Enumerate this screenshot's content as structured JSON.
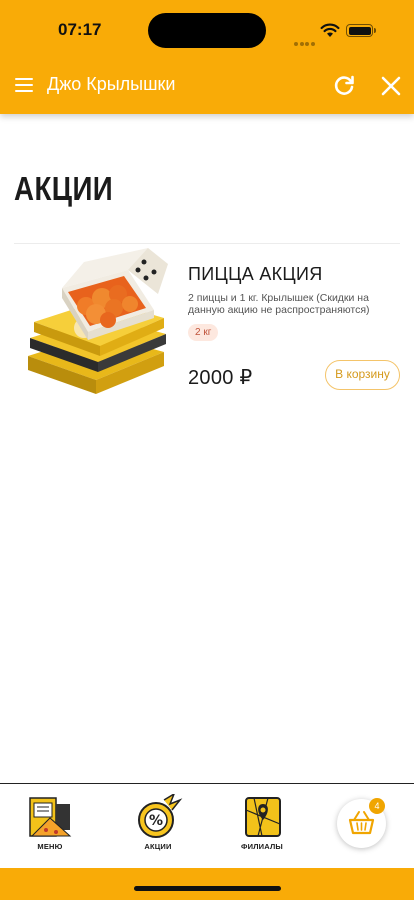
{
  "status_bar": {
    "time": "07:17"
  },
  "header": {
    "title": "Джо Крылышки"
  },
  "page": {
    "title": "АКЦИИ"
  },
  "products": [
    {
      "name": "ПИЦЦА АКЦИЯ",
      "description": "2 пиццы и 1 кг. Крылышек (Скидки на данную акцию не распространяются)",
      "weight": "2 кг",
      "price": "2000 ₽",
      "cart_label": "В корзину"
    }
  ],
  "tabbar": {
    "tabs": [
      {
        "label": "МЕНЮ",
        "icon": "menu-icon"
      },
      {
        "label": "АКЦИИ",
        "icon": "percent-icon"
      },
      {
        "label": "ФИЛИАЛЫ",
        "icon": "map-icon"
      }
    ],
    "basket_count": "4"
  },
  "colors": {
    "brand": "#f9ab07",
    "accent_border": "#f4c46a",
    "badge_bg": "#fde8df"
  }
}
